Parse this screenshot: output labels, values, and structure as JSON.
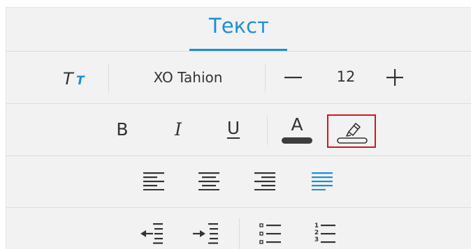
{
  "tabs": [
    {
      "label": "Текст",
      "active": true
    }
  ],
  "font": {
    "style_icon": "text-style-icon",
    "family": "XO Tahion",
    "size": "12"
  },
  "format_buttons": [
    {
      "name": "bold",
      "label": "B"
    },
    {
      "name": "italic",
      "label": "I"
    },
    {
      "name": "underline",
      "label": "U"
    },
    {
      "name": "font-color",
      "label": "A"
    },
    {
      "name": "highlight",
      "icon": "highlighter-icon"
    }
  ],
  "alignment": [
    "align-left-icon",
    "align-center-icon",
    "align-right-icon",
    "align-justify-icon"
  ],
  "alignment_active": "align-justify-icon",
  "lists": [
    "outdent-icon",
    "indent-icon",
    "bullet-list-icon",
    "numbered-list-icon"
  ],
  "numbered_list_digits": [
    "1",
    "2",
    "3"
  ],
  "colors": {
    "accent": "#1b8fd6",
    "text": "#333333",
    "highlight_frame": "#d0171e",
    "panel": "#f2f2f2"
  }
}
